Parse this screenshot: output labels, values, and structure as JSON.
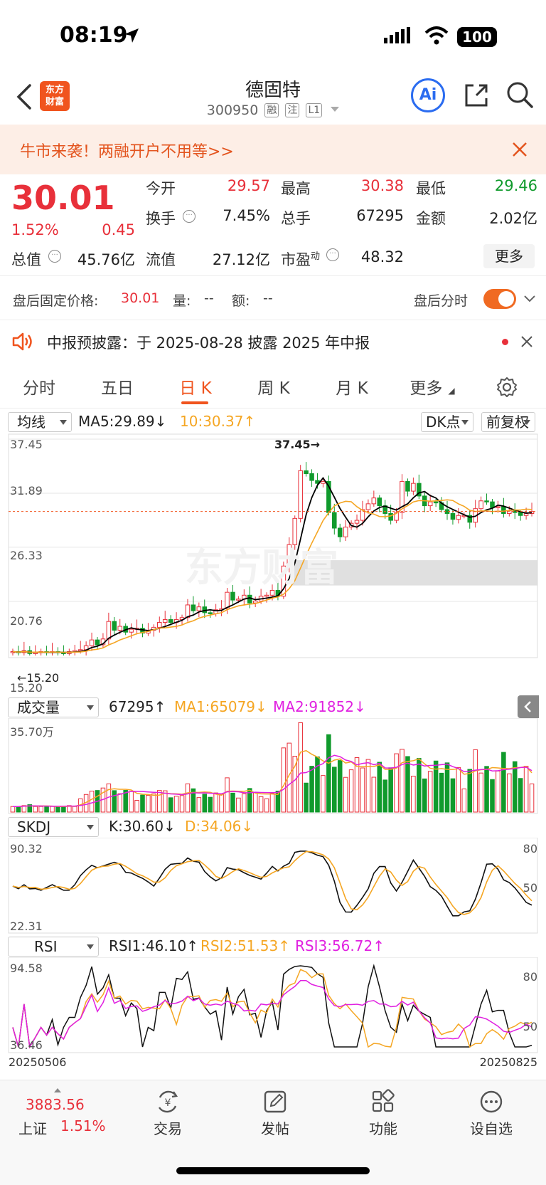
{
  "status": {
    "time": "08:19",
    "battery": "100"
  },
  "header": {
    "logo": "东方\n财富",
    "title": "德固特",
    "code": "300950",
    "tags": [
      "融",
      "注",
      "L1"
    ]
  },
  "banner": {
    "text": "牛市来袭！两融开户不用等>>"
  },
  "quote": {
    "price": "30.01",
    "pct": "1.52%",
    "chg": "0.45",
    "items": [
      {
        "label": "今开",
        "value": "29.57",
        "color": "red"
      },
      {
        "label": "最高",
        "value": "30.38",
        "color": "red"
      },
      {
        "label": "最低",
        "value": "29.46",
        "color": "green"
      },
      {
        "label": "换手",
        "value": "7.45%",
        "color": "normal"
      },
      {
        "label": "总手",
        "value": "67295",
        "color": "normal"
      },
      {
        "label": "金额",
        "value": "2.02亿",
        "color": "normal"
      },
      {
        "label": "总值",
        "value": "45.76亿",
        "color": "normal"
      },
      {
        "label": "流值",
        "value": "27.12亿",
        "color": "normal"
      },
      {
        "label": "市盈",
        "value": "48.32",
        "color": "normal"
      }
    ],
    "pe_sup": "动",
    "more": "更多"
  },
  "after_hours": {
    "label": "盘后固定价格:",
    "price": "30.01",
    "vol_label": "量:",
    "vol": "--",
    "amt_label": "额:",
    "amt": "--",
    "time_label": "盘后分时"
  },
  "notice": {
    "text": "中报预披露：于 2025-08-28 披露 2025 年中报"
  },
  "tabs": [
    "分时",
    "五日",
    "日 K",
    "周 K",
    "月 K",
    "更多"
  ],
  "active_tab": "日 K",
  "kline": {
    "selector": "均线",
    "ma5": "MA5:29.89",
    "ma5_arrow": "↓",
    "time": "10:30.37",
    "time_arrow": "↑",
    "dk_btn": "DK点",
    "adjust_btn": "前复权",
    "yticks": [
      "37.45",
      "31.89",
      "26.33",
      "20.76",
      "15.20"
    ],
    "high_label": "37.45→",
    "low_label": "←15.20",
    "watermark": "东方财富"
  },
  "volume": {
    "selector": "成交量",
    "val": "67295",
    "val_arrow": "↑",
    "ma1": "MA1:65079",
    "ma1_arrow": "↓",
    "ma2": "MA2:91852",
    "ma2_arrow": "↓",
    "ymax": "35.70万"
  },
  "skdj": {
    "selector": "SKDJ",
    "k": "K:30.60",
    "k_arrow": "↓",
    "d": "D:34.06",
    "d_arrow": "↓",
    "ymax": "90.32",
    "ymin": "22.31",
    "r80": "80",
    "r50": "50"
  },
  "rsi": {
    "selector": "RSI",
    "rsi1": "RSI1:46.10",
    "rsi1_arrow": "↑",
    "rsi2": "RSI2:51.53",
    "rsi2_arrow": "↑",
    "rsi3": "RSI3:56.72",
    "rsi3_arrow": "↑",
    "ymax": "94.58",
    "ymin": "36.46",
    "r80": "80",
    "r50": "50",
    "date_start": "20250506",
    "date_end": "20250825"
  },
  "bottom_nav": {
    "index_value": "3883.56",
    "index_name": "上证",
    "index_pct": "1.51%",
    "items": [
      "交易",
      "发帖",
      "功能",
      "设自选"
    ]
  },
  "colors": {
    "up": "#e8303a",
    "down": "#109a2c",
    "accent": "#f0541e",
    "ma5": "#000000",
    "ma10": "#f5a623",
    "ma_pink": "#e020e0"
  },
  "chart_data": {
    "type": "candlestick",
    "y_range": [
      15.2,
      37.45
    ],
    "x_range": [
      "20250506",
      "20250825"
    ],
    "last_close": 30.01,
    "ma5": 29.89,
    "volume": 67295,
    "vol_ma1": 65079,
    "vol_ma2": 91852,
    "skdj": {
      "K": 30.6,
      "D": 34.06
    },
    "rsi": {
      "RSI1": 46.1,
      "RSI2": 51.53,
      "RSI3": 56.72
    },
    "closes": [
      15.6,
      15.5,
      15.7,
      15.4,
      15.5,
      15.6,
      15.5,
      15.6,
      15.5,
      15.4,
      15.6,
      15.7,
      15.8,
      16.2,
      16.8,
      16.3,
      16.9,
      18.7,
      17.8,
      18.2,
      17.6,
      17.9,
      18.0,
      17.5,
      17.8,
      18.1,
      18.6,
      18.9,
      18.6,
      18.9,
      19.1,
      20.4,
      19.8,
      20.2,
      19.6,
      19.5,
      19.9,
      20.0,
      21.7,
      20.9,
      21.0,
      21.4,
      20.6,
      20.8,
      21.3,
      21.4,
      21.9,
      21.3,
      24.4,
      26.6,
      29.3,
      34.2,
      33.9,
      33.2,
      32.9,
      33.1,
      29.9,
      28.3,
      27.4,
      28.4,
      28.8,
      29.1,
      30.2,
      30.8,
      31.4,
      30.6,
      29.8,
      29.1,
      29.9,
      33.1,
      32.1,
      32.9,
      31.6,
      30.6,
      31.0,
      30.9,
      30.2,
      29.8,
      29.2,
      29.6,
      29.6,
      28.9,
      30.3,
      31.1,
      31.0,
      30.4,
      30.5,
      29.8,
      30.1,
      29.9,
      29.6,
      29.8,
      30.01
    ]
  }
}
